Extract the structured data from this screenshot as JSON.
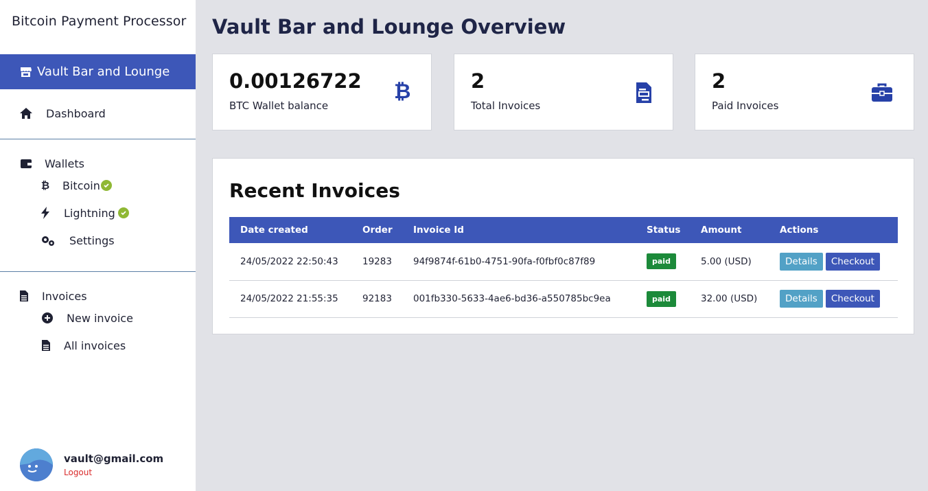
{
  "app": {
    "title": "Bitcoin Payment Processor"
  },
  "store": {
    "name": "Vault Bar and Lounge"
  },
  "nav": {
    "dashboard": "Dashboard",
    "wallets": "Wallets",
    "bitcoin": "Bitcoin",
    "lightning": "Lightning",
    "settings": "Settings",
    "invoices": "Invoices",
    "new_invoice": "New invoice",
    "all_invoices": "All invoices"
  },
  "user": {
    "email": "vault@gmail.com",
    "logout": "Logout"
  },
  "page": {
    "title": "Vault Bar and Lounge Overview"
  },
  "stats": [
    {
      "value": "0.00126722",
      "label": "BTC Wallet balance",
      "icon": "bitcoin-icon"
    },
    {
      "value": "2",
      "label": "Total Invoices",
      "icon": "invoice-icon"
    },
    {
      "value": "2",
      "label": "Paid Invoices",
      "icon": "briefcase-icon"
    }
  ],
  "recent": {
    "title": "Recent Invoices",
    "columns": [
      "Date created",
      "Order",
      "Invoice Id",
      "Status",
      "Amount",
      "Actions"
    ],
    "rows": [
      {
        "date": "24/05/2022 22:50:43",
        "order": "19283",
        "id": "94f9874f-61b0-4751-90fa-f0fbf0c87f89",
        "status": "paid",
        "amount": "5.00 (USD)",
        "details": "Details",
        "checkout": "Checkout"
      },
      {
        "date": "24/05/2022 21:55:35",
        "order": "92183",
        "id": "001fb330-5633-4ae6-bd36-a550785bc9ea",
        "status": "paid",
        "amount": "32.00 (USD)",
        "details": "Details",
        "checkout": "Checkout"
      }
    ]
  },
  "colors": {
    "accent": "#3d57b8",
    "paid": "#1c8a3a",
    "details": "#52a1c6",
    "check": "#8fb834",
    "logout": "#d92b2b"
  }
}
